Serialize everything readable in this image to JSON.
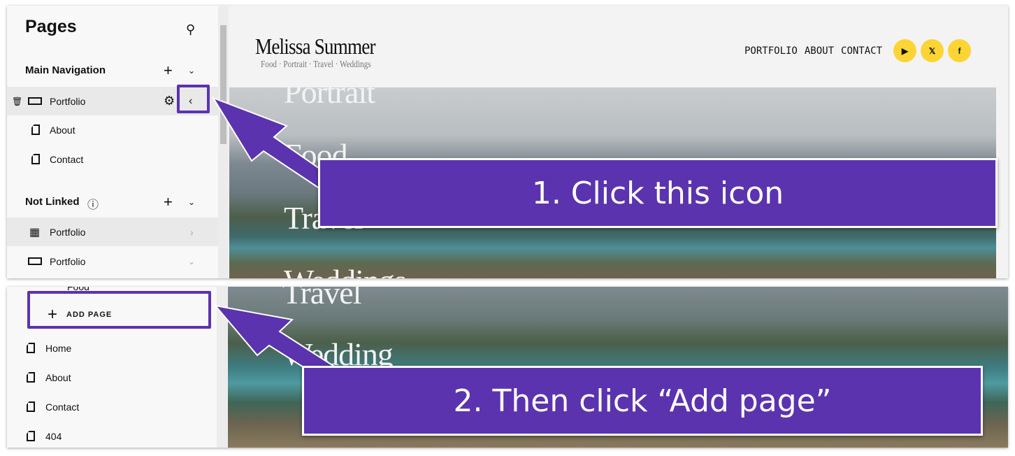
{
  "sidebar": {
    "title": "Pages",
    "main_nav": "Main Navigation",
    "not_linked": "Not Linked",
    "main_items": [
      {
        "label": "Portfolio"
      },
      {
        "label": "About"
      },
      {
        "label": "Contact"
      }
    ],
    "not_linked_items": [
      {
        "label": "Portfolio"
      },
      {
        "label": "Portfolio"
      }
    ],
    "partial_item": "Food",
    "add_page": "ADD PAGE",
    "bottom_items": [
      {
        "label": "Home"
      },
      {
        "label": "About"
      },
      {
        "label": "Contact"
      },
      {
        "label": "404"
      }
    ]
  },
  "site": {
    "name": "Melissa Summer",
    "tagline": "Food · Portrait · Travel · Weddings",
    "nav": [
      "PORTFOLIO",
      "ABOUT",
      "CONTACT"
    ],
    "hero_words_top": [
      "Portrait",
      "Food",
      "Travel",
      "Weddings"
    ],
    "hero_words_bottom": [
      "Travel",
      "Wedding"
    ]
  },
  "callouts": {
    "step1": "1.  Click this icon",
    "step2": "2. Then click “Add page”"
  },
  "colors": {
    "accent": "#5b33ae",
    "social": "#fcd535"
  }
}
